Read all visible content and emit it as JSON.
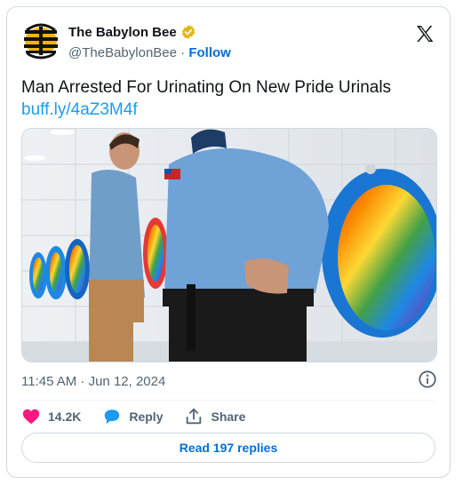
{
  "author": {
    "name": "The Babylon Bee",
    "handle": "@TheBabylonBee",
    "separator": "·",
    "follow_label": "Follow"
  },
  "tweet": {
    "text": "Man Arrested For Urinating On New Pride Urinals",
    "link": "buff.ly/4aZ3M4f",
    "timestamp": "11:45 AM · Jun 12, 2024"
  },
  "actions": {
    "likes": "14.2K",
    "reply_label": "Reply",
    "share_label": "Share"
  },
  "read_replies_label": "Read 197 replies",
  "colors": {
    "link": "#1d9bf0",
    "follow": "#006fd6",
    "like": "#f91880",
    "reply": "#1d9bf0",
    "muted": "#536471",
    "verified_gold": "#e2b719"
  },
  "icons": [
    "babylon-bee-logo-icon",
    "verified-badge-icon",
    "x-logo-icon",
    "info-icon",
    "heart-icon",
    "reply-bubble-icon",
    "share-icon"
  ]
}
